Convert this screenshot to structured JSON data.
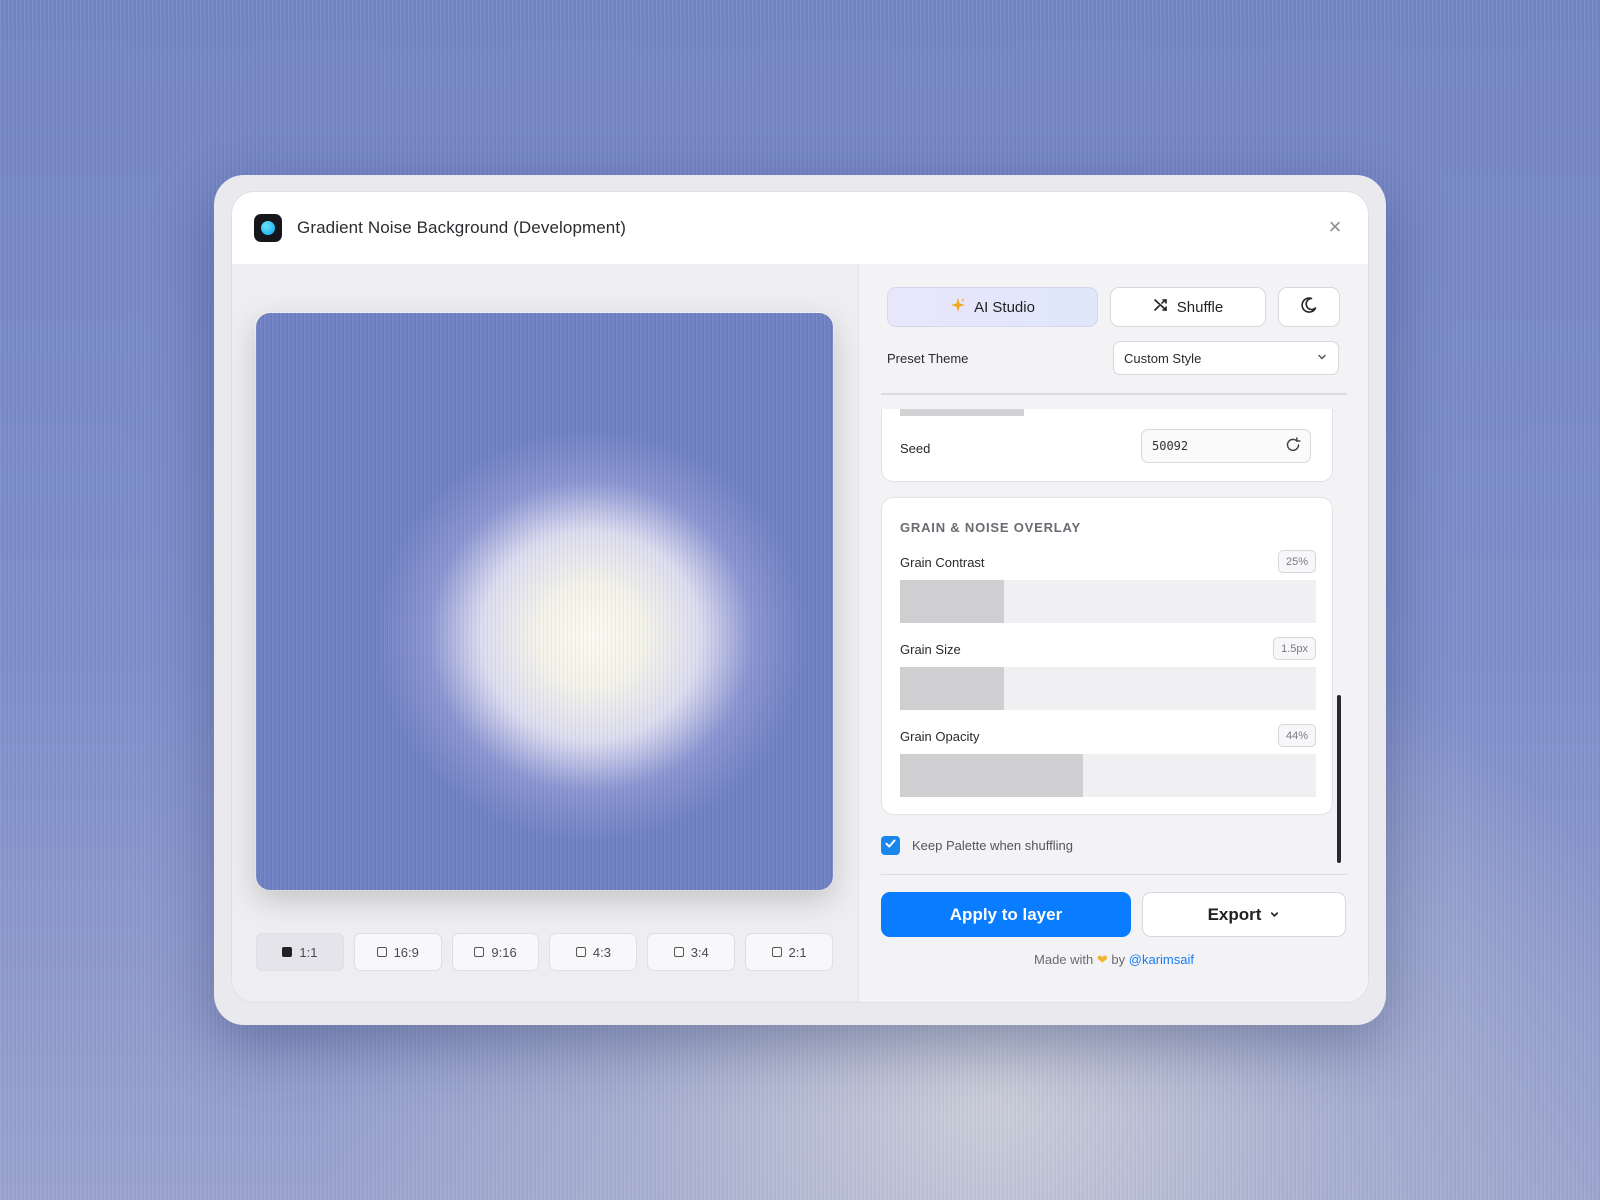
{
  "window": {
    "title": "Gradient Noise Background (Development)",
    "close_symbol": "×"
  },
  "ratios": [
    {
      "label": "1:1",
      "active": true
    },
    {
      "label": "16:9",
      "active": false
    },
    {
      "label": "9:16",
      "active": false
    },
    {
      "label": "4:3",
      "active": false
    },
    {
      "label": "3:4",
      "active": false
    },
    {
      "label": "2:1",
      "active": false
    }
  ],
  "toolbar": {
    "ai_label": "AI Studio",
    "shuffle_label": "Shuffle"
  },
  "preset": {
    "label": "Preset Theme",
    "value": "Custom Style"
  },
  "seed": {
    "label": "Seed",
    "value": "50092"
  },
  "grain": {
    "heading": "GRAIN & NOISE OVERLAY",
    "contrast": {
      "label": "Grain Contrast",
      "value": "25%",
      "fill": 0.25
    },
    "size": {
      "label": "Grain Size",
      "value": "1.5px",
      "fill": 0.25
    },
    "opacity": {
      "label": "Grain Opacity",
      "value": "44%",
      "fill": 0.44
    }
  },
  "keep_palette": {
    "label": "Keep Palette when shuffling",
    "checked": true
  },
  "actions": {
    "apply_label": "Apply to layer",
    "export_label": "Export"
  },
  "credit": {
    "prefix": "Made with",
    "by": "by",
    "handle": "@karimsaif"
  },
  "colors": {
    "accent": "#0a7cff",
    "checkbox": "#1a86ee",
    "background": "#7485c6"
  },
  "icons": [
    "app-icon",
    "close-icon",
    "sparkle-icon",
    "shuffle-icon",
    "moon-icon",
    "chevron-down-icon",
    "refresh-icon",
    "check-icon",
    "heart-icon"
  ]
}
